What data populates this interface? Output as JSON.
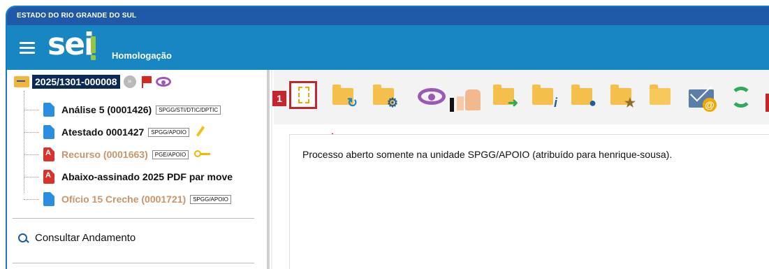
{
  "header": {
    "gov_title": "ESTADO DO RIO GRANDE DO SUL",
    "logo_text": "sei",
    "environment": "Homologação"
  },
  "process": {
    "number": "2025/1301-000008"
  },
  "documents": [
    {
      "name": "Análise 5 (0001426)",
      "unit": "SPGG/STI/DTIC/DPTIC",
      "type": "html",
      "muted": false
    },
    {
      "name": "Atestado 0001427",
      "unit": "SPGG/APOIO",
      "type": "html",
      "muted": false
    },
    {
      "name": "Recurso (0001663)",
      "unit": "PGE/APOIO",
      "type": "pdf",
      "muted": true
    },
    {
      "name": "Abaixo-assinado 2025 PDF par move",
      "unit": "",
      "type": "pdf",
      "muted": false
    },
    {
      "name": "Ofício 15 Creche (0001721)",
      "unit": "SPGG/APOIO",
      "type": "html",
      "muted": true
    }
  ],
  "sidebar": {
    "consultar_label": "Consultar Andamento"
  },
  "toolbar": {
    "callout_number": "1",
    "icons": [
      "new-document-icon",
      "send-process-icon",
      "manage-icon",
      "view-icon",
      "thumb-icon",
      "forward-icon",
      "info-icon",
      "assign-icon",
      "bookmark-icon",
      "folder-icon",
      "email-icon",
      "refresh-icon"
    ]
  },
  "content": {
    "message_prefix": "Processo aberto somente na unidade ",
    "message_unit": "SPGG/APOIO",
    "message_mid": " (atribuído para ",
    "message_user": "henrique-sousa",
    "message_suffix": ")."
  },
  "colors": {
    "gov_bar": "#1f5aa8",
    "header": "#1786c3",
    "callout": "#c4262e",
    "process_highlight": "#0a2a55"
  }
}
